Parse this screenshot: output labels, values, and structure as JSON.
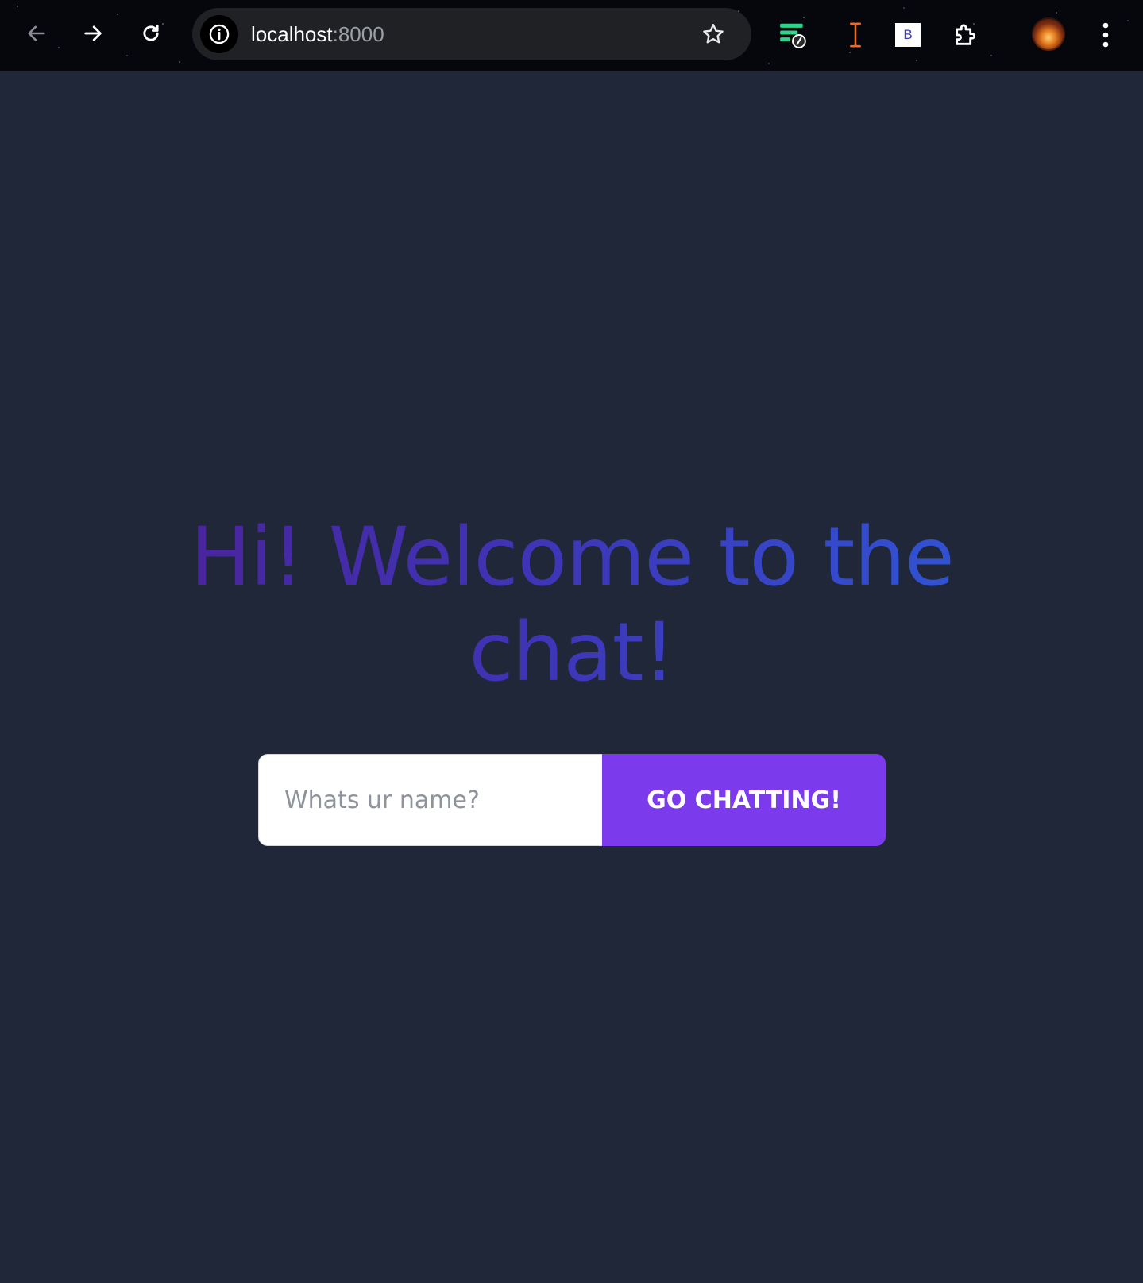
{
  "browser": {
    "url_host": "localhost",
    "url_port": ":8000",
    "icons": {
      "back": "arrow-left-icon",
      "forward": "arrow-right-icon",
      "reload": "reload-icon",
      "site_info": "info-icon",
      "bookmark": "star-icon",
      "extension_1": "lines-badge-icon",
      "extension_2": "text-cursor-icon",
      "extension_3": "b-square-icon",
      "extensions": "puzzle-icon",
      "menu": "kebab-menu-icon"
    },
    "extension_3_label": "B"
  },
  "hero": {
    "headline": "Hi! Welcome to the chat!"
  },
  "form": {
    "name_placeholder": "Whats ur name?",
    "name_value": "",
    "submit_label": "GO CHATTING!"
  },
  "colors": {
    "page_background": "#1f2738",
    "button_background": "#7c3aed",
    "headline_gradient_start": "#4b2299",
    "headline_gradient_end": "#2f56d6"
  }
}
